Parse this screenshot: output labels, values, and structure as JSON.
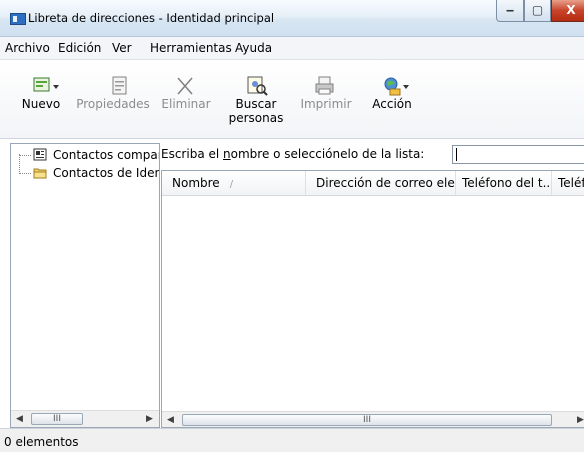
{
  "window": {
    "title": "Libreta de direcciones - Identidad principal",
    "controls": {
      "minimize": "‒",
      "maximize": "▢",
      "close": "X"
    }
  },
  "menu": [
    "Archivo",
    "Edición",
    "Ver",
    "Herramientas",
    "Ayuda"
  ],
  "toolbar": {
    "nuevo": "Nuevo",
    "propiedades": "Propiedades",
    "eliminar": "Eliminar",
    "buscar_1": "Buscar",
    "buscar_2": "personas",
    "imprimir": "Imprimir",
    "accion": "Acción"
  },
  "tree": {
    "items": [
      {
        "label": "Contactos compartidos"
      },
      {
        "label": "Contactos de Identidad principal"
      }
    ]
  },
  "search": {
    "label_prefix": "Escriba el ",
    "label_underlined": "n",
    "label_suffix": "ombre o selecciónelo de la lista:",
    "value": ""
  },
  "list": {
    "columns": [
      "Nombre",
      "Dirección de correo ele...",
      "Teléfono del t...",
      "Teléfono"
    ],
    "sort_indicator": "/"
  },
  "scroll": {
    "left_arrow": "◀",
    "right_arrow": "▶",
    "grip": "III"
  },
  "status": {
    "text": "0 elementos"
  },
  "colors": {
    "titlebar": "#dbe8f5",
    "close_button": "#c7442a",
    "border": "#9aa7b7"
  }
}
